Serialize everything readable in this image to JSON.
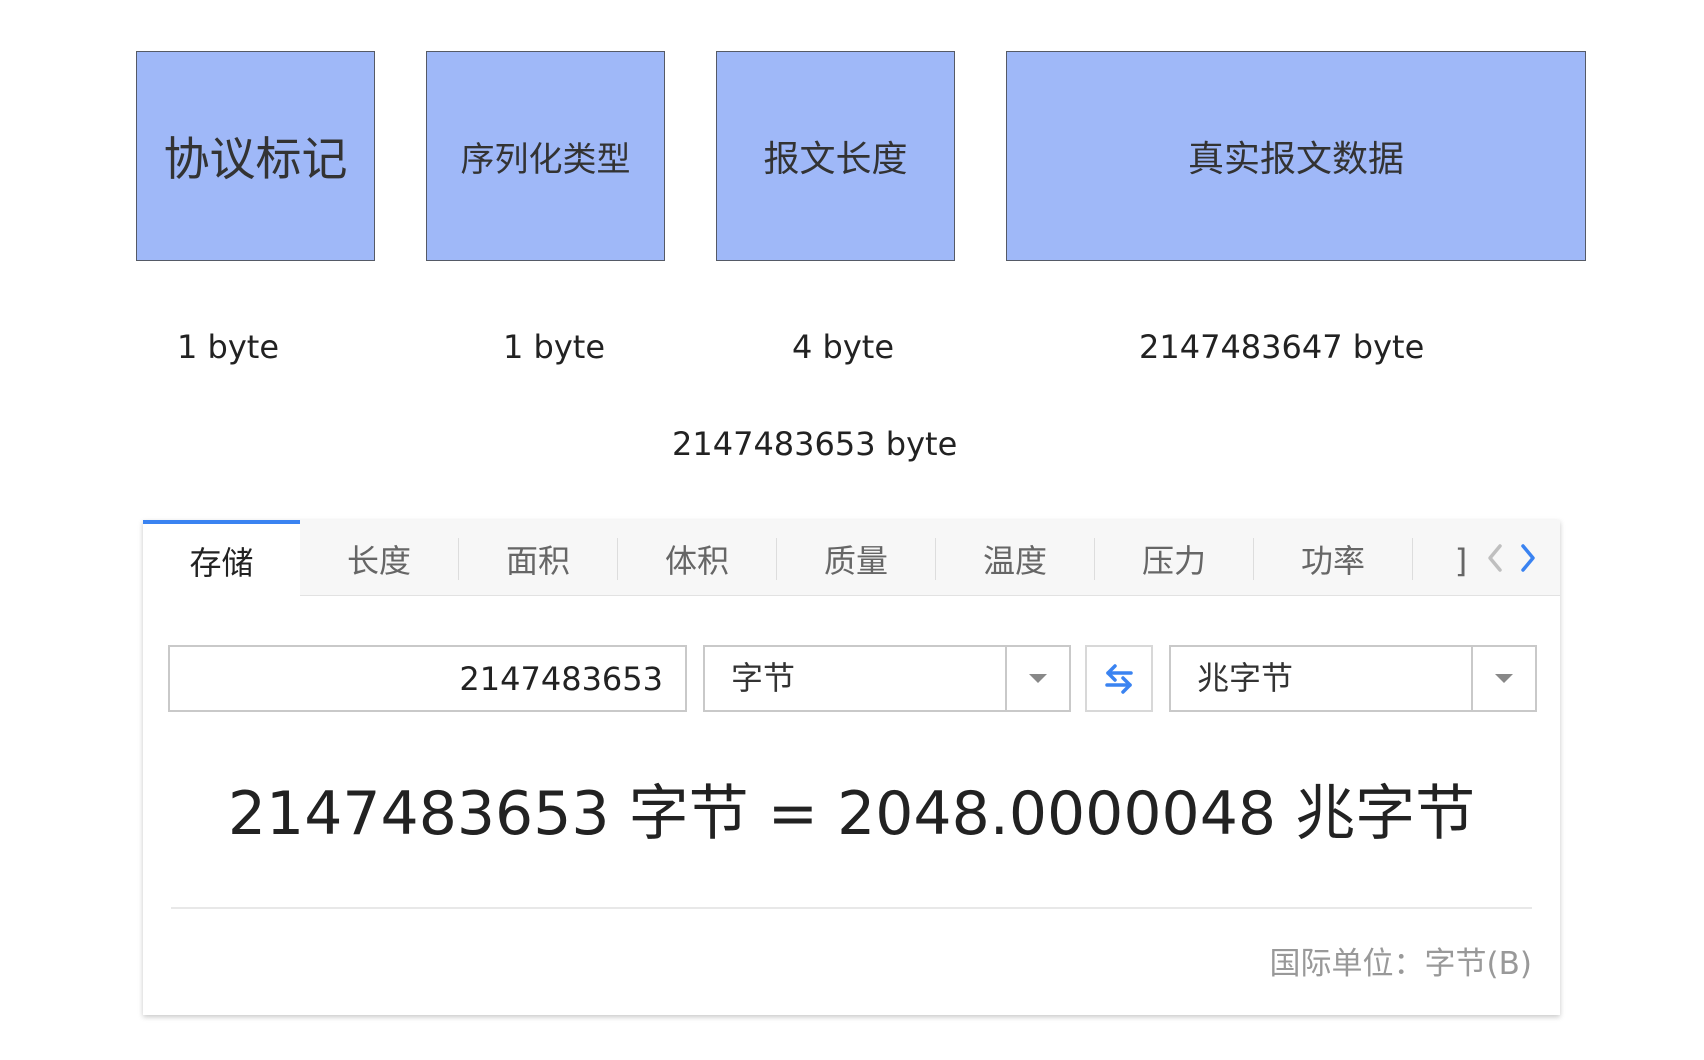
{
  "diagram": {
    "fields": [
      {
        "label": "协议标记",
        "size": "1 byte"
      },
      {
        "label": "序列化类型",
        "size": "1 byte"
      },
      {
        "label": "报文长度",
        "size": "4 byte"
      },
      {
        "label": "真实报文数据",
        "size": "2147483647 byte"
      }
    ],
    "total": "2147483653 byte",
    "box_color": "#9fb8f8"
  },
  "converter": {
    "tabs": [
      {
        "label": "存储",
        "active": true
      },
      {
        "label": "长度"
      },
      {
        "label": "面积"
      },
      {
        "label": "体积"
      },
      {
        "label": "质量"
      },
      {
        "label": "温度"
      },
      {
        "label": "压力"
      },
      {
        "label": "功率"
      },
      {
        "label": "]"
      }
    ],
    "prev_icon": "chevron-left-icon",
    "next_icon": "chevron-right-icon",
    "input_value": "2147483653",
    "from_unit": "字节",
    "to_unit": "兆字节",
    "swap_icon": "swap-arrows-icon",
    "result": "2147483653 字节 = 2048.0000048 兆字节",
    "si_unit": "国际单位：字节(B)",
    "accent_color": "#3a83f1"
  }
}
